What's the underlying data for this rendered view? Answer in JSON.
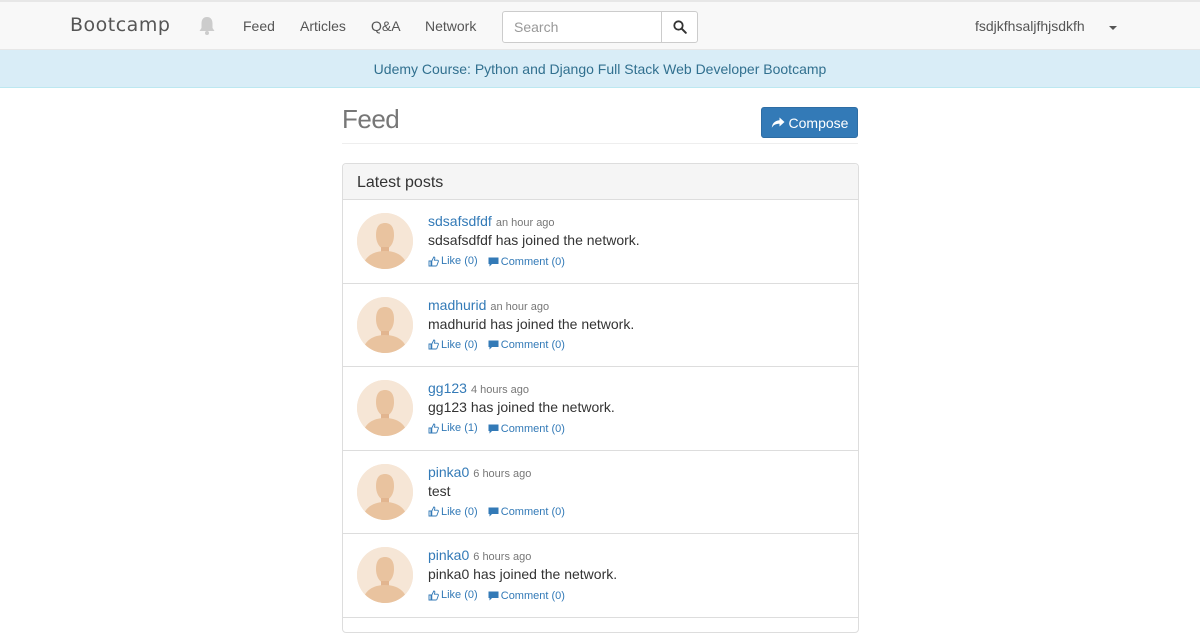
{
  "navbar": {
    "brand": "Bootcamp",
    "links": [
      "Feed",
      "Articles",
      "Q&A",
      "Network"
    ],
    "search_placeholder": "Search",
    "user": "fsdjkfhsaljfhjsdkfh"
  },
  "banner": {
    "text": "Udemy Course: Python and Django Full Stack Web Developer Bootcamp"
  },
  "page": {
    "title": "Feed",
    "compose_label": "Compose"
  },
  "panel": {
    "heading": "Latest posts",
    "posts": [
      {
        "user": "sdsafsdfdf",
        "time": "an hour ago",
        "text": "sdsafsdfdf has joined the network.",
        "like": "Like (0)",
        "comment": "Comment (0)"
      },
      {
        "user": "madhurid",
        "time": "an hour ago",
        "text": "madhurid has joined the network.",
        "like": "Like (0)",
        "comment": "Comment (0)"
      },
      {
        "user": "gg123",
        "time": "4 hours ago",
        "text": "gg123 has joined the network.",
        "like": "Like (1)",
        "comment": "Comment (0)"
      },
      {
        "user": "pinka0",
        "time": "6 hours ago",
        "text": "test",
        "like": "Like (0)",
        "comment": "Comment (0)"
      },
      {
        "user": "pinka0",
        "time": "6 hours ago",
        "text": "pinka0 has joined the network.",
        "like": "Like (0)",
        "comment": "Comment (0)"
      }
    ]
  },
  "colors": {
    "link": "#337ab7",
    "banner_bg": "#d9edf7",
    "banner_text": "#31708f",
    "primary": "#337ab7"
  }
}
